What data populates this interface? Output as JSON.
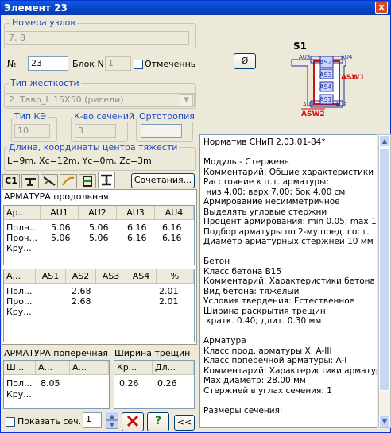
{
  "window": {
    "title": "Элемент 23",
    "close_glyph": "x"
  },
  "nodes": {
    "label": "Номера узлов",
    "value": "7, 8"
  },
  "number": {
    "label": "№",
    "value": "23"
  },
  "block": {
    "label": "Блок N",
    "value": "1"
  },
  "marked": {
    "label": "Отмеченный",
    "checked": false
  },
  "stiffness": {
    "label": "Тип жесткости",
    "value": "2. Тавр_L 15X50 (ригели)"
  },
  "ke_type": {
    "label": "Тип КЭ",
    "value": "10"
  },
  "sections_count": {
    "label": "К-во сечений",
    "value": "3"
  },
  "orthotropy": {
    "label": "Ортотропия",
    "value": ""
  },
  "length": {
    "label": "Длина, координаты центра тяжести",
    "value": "L=9m, Xc=12m, Yc=0m, Zc=3m"
  },
  "combinations_button": "Сочетания...",
  "tabs": {
    "c1_label": "C1",
    "icons": [
      "beam-icon",
      "diagonal-icon",
      "curve-icon",
      "section-icon",
      "rebar-icon"
    ]
  },
  "long_rebar": {
    "title": "АРМАТУРА продольная",
    "table1": {
      "headers": [
        "Ар...",
        "AU1",
        "AU2",
        "AU3",
        "AU4"
      ],
      "rows": [
        [
          "Полн...",
          "5.06",
          "5.06",
          "6.16",
          "6.16"
        ],
        [
          "Проч...",
          "5.06",
          "5.06",
          "6.16",
          "6.16"
        ],
        [
          "Кру...",
          "",
          "",
          "",
          ""
        ]
      ]
    },
    "table2": {
      "headers": [
        "А...",
        "AS1",
        "AS2",
        "AS3",
        "AS4",
        "%"
      ],
      "rows": [
        [
          "Пол...",
          "",
          "2.68",
          "",
          "",
          "2.01"
        ],
        [
          "Про...",
          "",
          "2.68",
          "",
          "",
          "2.01"
        ],
        [
          "Кру...",
          "",
          "",
          "",
          "",
          ""
        ]
      ]
    }
  },
  "transverse": {
    "title": "АРМАТУРА поперечная",
    "headers": [
      "Ш...",
      "А...",
      "А..."
    ],
    "rows": [
      [
        "Пол...",
        "8.05",
        ""
      ],
      [
        "Кру...",
        "",
        ""
      ]
    ]
  },
  "crack": {
    "title": "Ширина трещин",
    "headers": [
      "Кр...",
      "Дл..."
    ],
    "rows": [
      [
        "0.26",
        "0.26"
      ]
    ]
  },
  "bottom": {
    "show_section_label": "Показать сеч.",
    "spinner_value": "1",
    "back_label": "<<"
  },
  "scheme": {
    "title": "S1",
    "labels": {
      "au3": "AU3",
      "au4": "AU4",
      "au1": "AU1",
      "au2": "AU2",
      "as1": "AS1",
      "as2": "AS2",
      "as3": "AS3",
      "as4": "AS4",
      "asw1": "ASW1",
      "asw2": "ASW2"
    },
    "diameter_button": "Ø"
  },
  "report": {
    "lines": [
      "Норматив СНиП 2.03.01-84*",
      "",
      "Модуль - Стержень",
      "Комментарий: Общие характеристики",
      "Расстояние к ц.т. арматуры:",
      " низ 4.00; верх 7.00; бок 4.00 см",
      "Армирование несимметричное",
      "Выделять угловые стержни",
      "Процент армирования: min 0.05; max 10.00",
      "Подбор арматуры по 2-му пред. сост.",
      "Диаметр арматурных стержней 10 мм",
      "",
      "Бетон",
      "Класс бетона В15",
      "Комментарий: Характеристики бетона",
      "Вид бетона: тяжелый",
      "Условия твердения: Естественное",
      "Ширина раскрытия трещин:",
      " кратк. 0.40; длит. 0.30 мм",
      "",
      "Арматура",
      "Класс прод. арматуры X: A-III",
      "Класс поперечной арматуры: A-I",
      "Комментарий: Характеристики арматуры",
      "Max диаметр: 28.00 мм",
      "Стержней в углах сечения: 1",
      "",
      "Размеры сечения:"
    ]
  },
  "colors": {
    "title_bar": "#0842c4",
    "group_label": "#1a48c8",
    "rebar_red": "#d01010",
    "section_blue": "#2030a0"
  }
}
